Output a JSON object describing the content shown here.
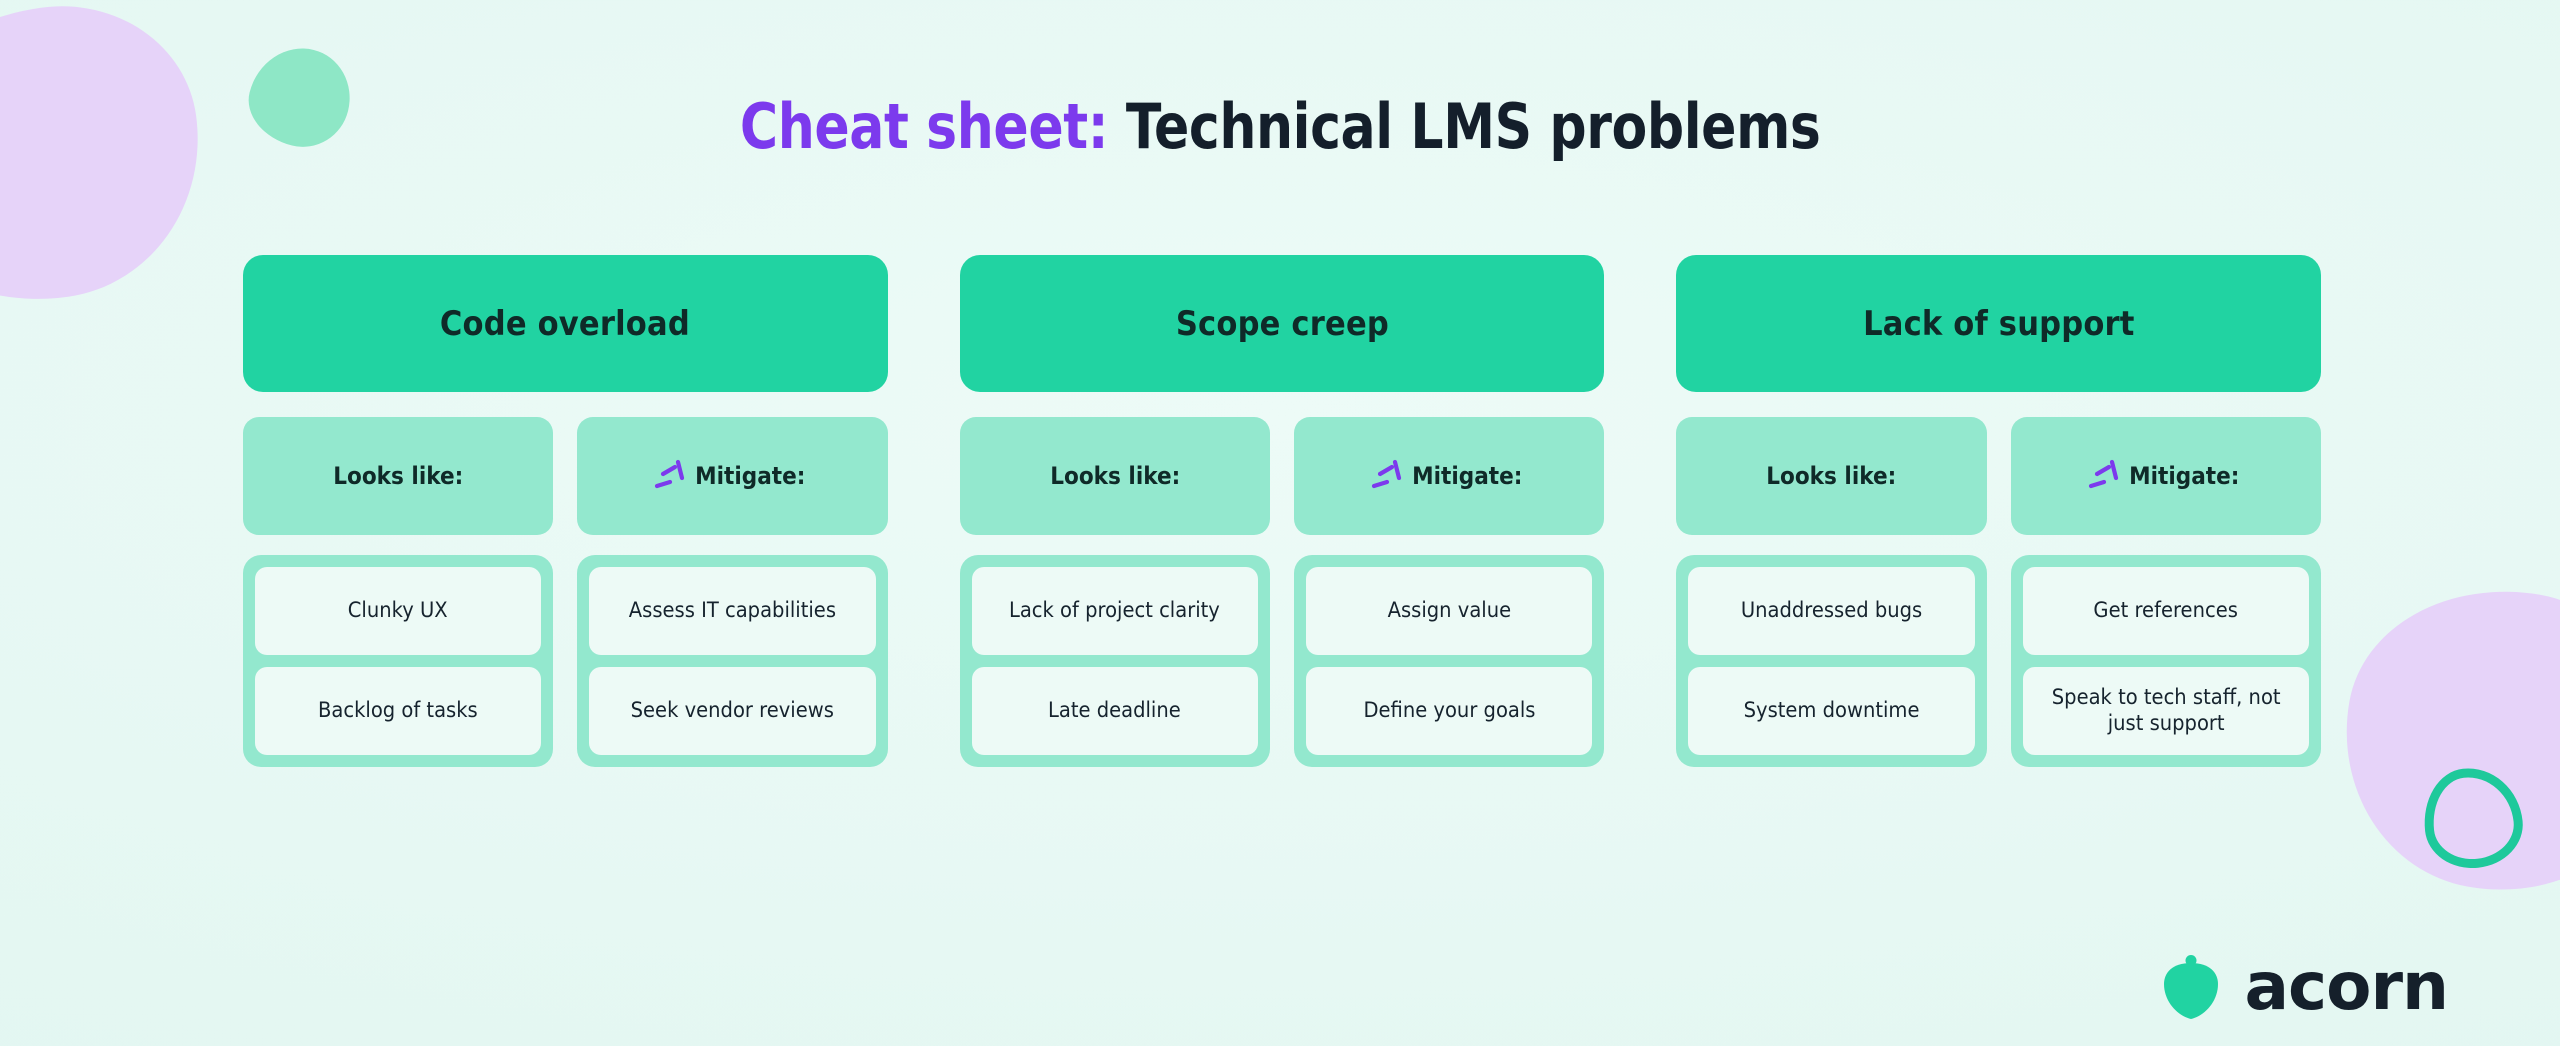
{
  "title": {
    "accent": "Cheat sheet:",
    "main": " Technical LMS problems"
  },
  "colors": {
    "background": "#e4f7f2",
    "header_green": "#21d3a2",
    "subhead_mint": "#93e8ce",
    "card_bg": "#edfaf6",
    "text_dark": "#16232e",
    "accent_purple": "#7c3aed",
    "blob_lavender": "#e6d3f9",
    "blob_mint": "#8ee7c6",
    "ring_green": "#1ec99b"
  },
  "labels": {
    "looks_like": "Looks like:",
    "mitigate": "Mitigate:"
  },
  "columns": [
    {
      "header": "Code overload",
      "looks_like": [
        "Clunky UX",
        "Backlog of tasks"
      ],
      "mitigate": [
        "Assess IT capabilities",
        "Seek vendor reviews"
      ]
    },
    {
      "header": "Scope creep",
      "looks_like": [
        "Lack of project clarity",
        "Late deadline"
      ],
      "mitigate": [
        "Assign value",
        "Define your goals"
      ]
    },
    {
      "header": "Lack of support",
      "looks_like": [
        "Unaddressed bugs",
        "System downtime"
      ],
      "mitigate": [
        "Get references",
        "Speak to tech staff, not just support"
      ]
    }
  ],
  "logo": {
    "wordmark": "acorn",
    "icon": "acorn-icon"
  }
}
